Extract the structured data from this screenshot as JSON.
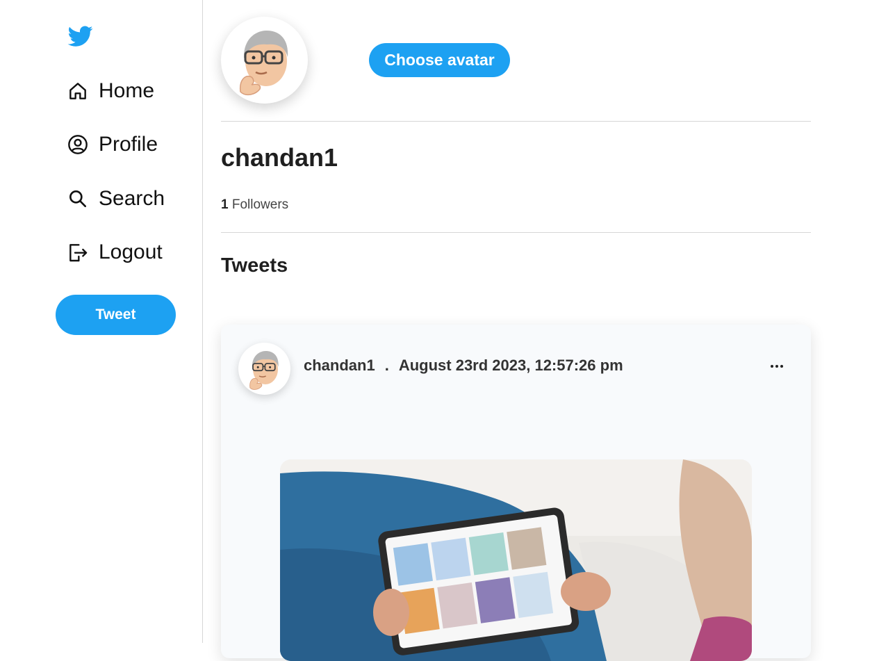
{
  "colors": {
    "accent": "#1da1f2",
    "divider": "#d6d6d6",
    "card_bg": "#f8fafc"
  },
  "sidebar": {
    "logo_icon": "twitter-bird-icon",
    "items": [
      {
        "label": "Home",
        "icon": "home-icon"
      },
      {
        "label": "Profile",
        "icon": "user-circle-icon"
      },
      {
        "label": "Search",
        "icon": "search-icon"
      },
      {
        "label": "Logout",
        "icon": "logout-icon"
      }
    ],
    "tweet_button": "Tweet"
  },
  "profile": {
    "choose_avatar_button": "Choose avatar",
    "username": "chandan1",
    "followers_count": "1",
    "followers_label": "Followers"
  },
  "tweets": {
    "title": "Tweets",
    "items": [
      {
        "author": "chandan1",
        "separator": ".",
        "timestamp": "August 23rd 2023, 12:57:26 pm",
        "more_icon": "more-horizontal-icon"
      }
    ]
  }
}
